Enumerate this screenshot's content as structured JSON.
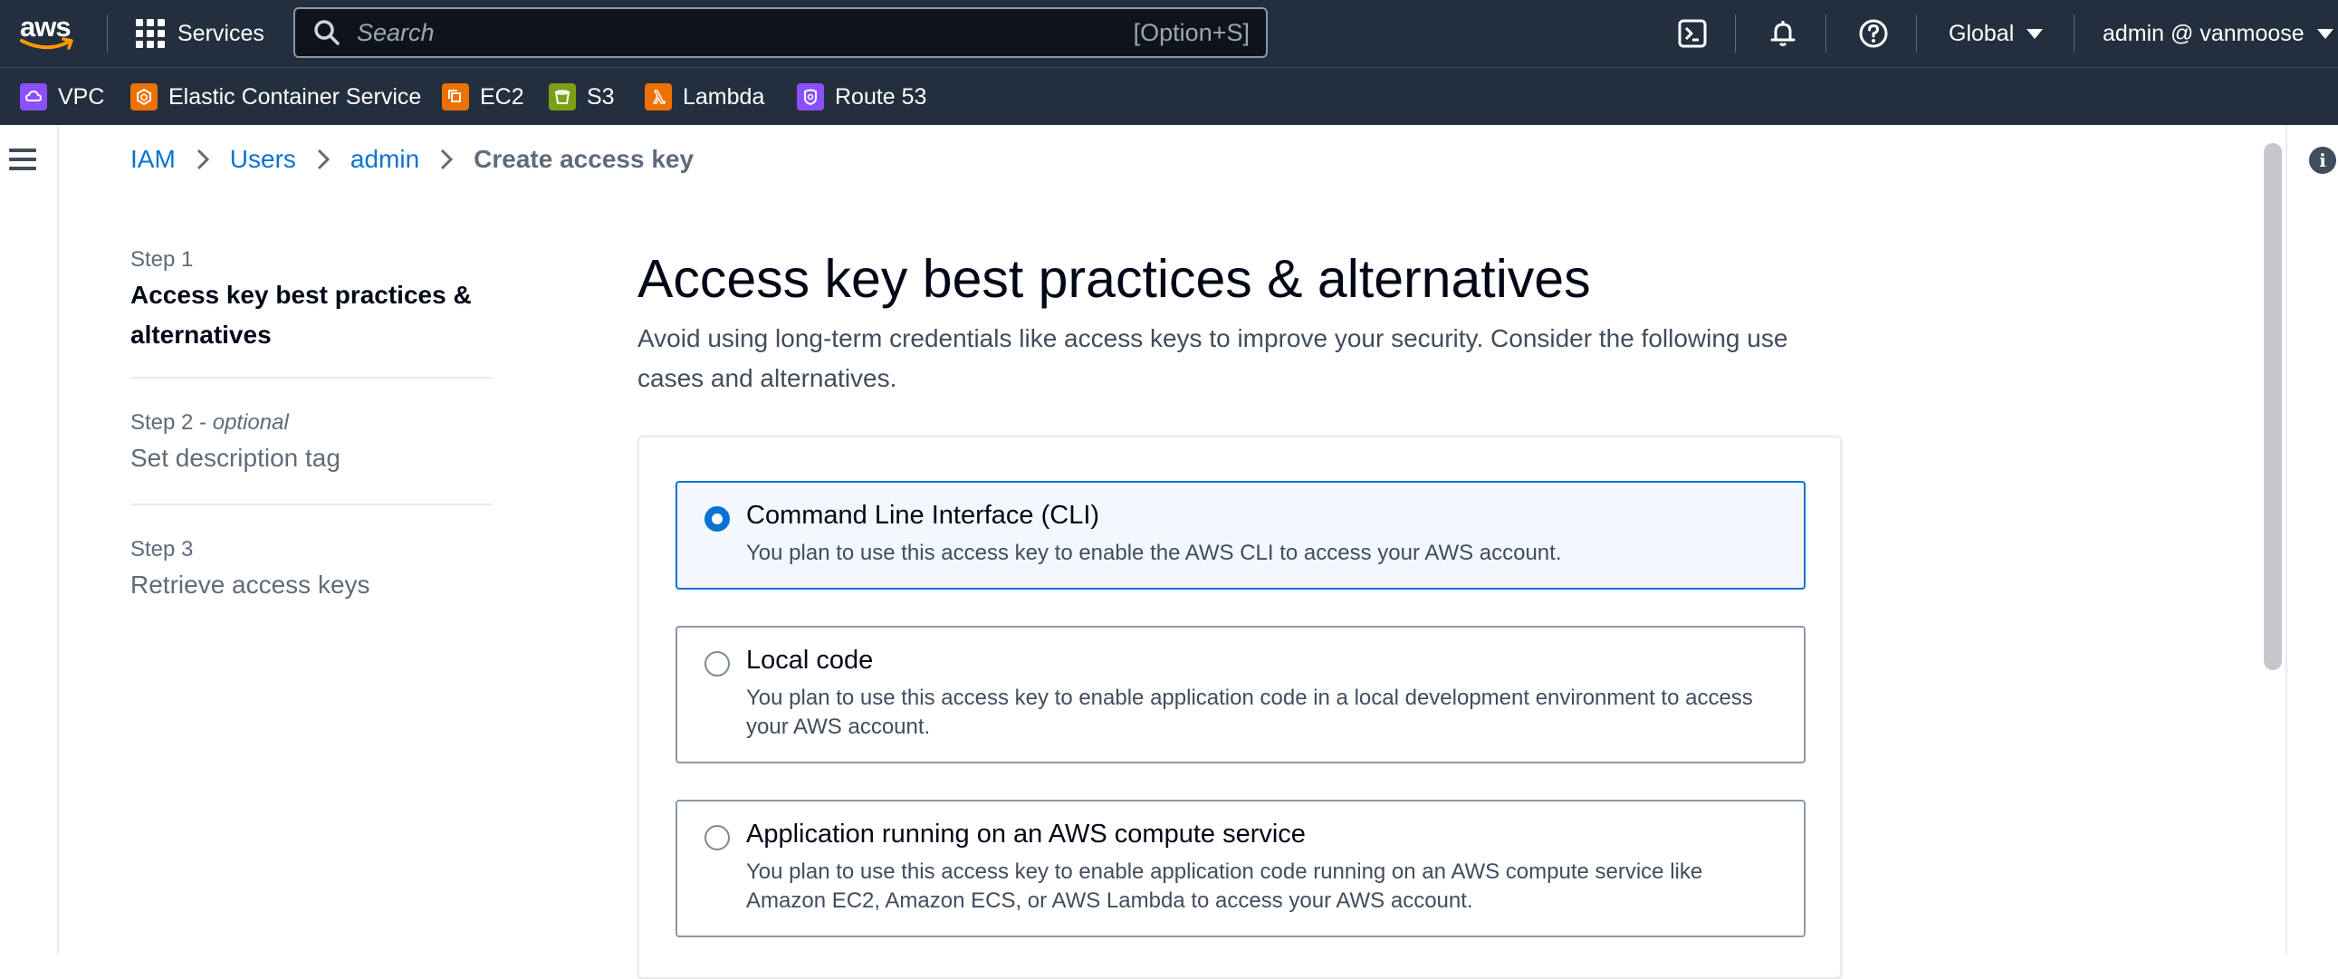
{
  "brand": {
    "logo_text": "aws"
  },
  "topnav": {
    "services_label": "Services",
    "search": {
      "placeholder": "Search",
      "shortcut": "[Option+S]"
    },
    "region": "Global",
    "account": "admin @ vanmoose"
  },
  "favorites": [
    {
      "label": "VPC",
      "icon": "vpc-icon",
      "color": "#8c4fff"
    },
    {
      "label": "Elastic Container Service",
      "icon": "ecs-icon",
      "color": "#ed7100"
    },
    {
      "label": "EC2",
      "icon": "ec2-icon",
      "color": "#ed7100"
    },
    {
      "label": "S3",
      "icon": "s3-icon",
      "color": "#7aa116"
    },
    {
      "label": "Lambda",
      "icon": "lambda-icon",
      "color": "#ed7100"
    },
    {
      "label": "Route 53",
      "icon": "route53-icon",
      "color": "#8c4fff"
    }
  ],
  "breadcrumb": {
    "items": [
      "IAM",
      "Users",
      "admin"
    ],
    "current": "Create access key"
  },
  "steps": [
    {
      "number": "Step 1",
      "optional": "",
      "title": "Access key best practices & alternatives",
      "active": true
    },
    {
      "number": "Step 2 - ",
      "optional": "optional",
      "title": "Set description tag",
      "active": false
    },
    {
      "number": "Step 3",
      "optional": "",
      "title": "Retrieve access keys",
      "active": false
    }
  ],
  "main": {
    "title": "Access key best practices & alternatives",
    "description": "Avoid using long-term credentials like access keys to improve your security. Consider the following use cases and alternatives.",
    "options": [
      {
        "title": "Command Line Interface (CLI)",
        "description": "You plan to use this access key to enable the AWS CLI to access your AWS account.",
        "selected": true
      },
      {
        "title": "Local code",
        "description": "You plan to use this access key to enable application code in a local development environment to access your AWS account.",
        "selected": false
      },
      {
        "title": "Application running on an AWS compute service",
        "description": "You plan to use this access key to enable application code running on an AWS compute service like Amazon EC2, Amazon ECS, or AWS Lambda to access your AWS account.",
        "selected": false
      }
    ]
  },
  "colors": {
    "nav_bg": "#232f3e",
    "link": "#0972d3",
    "selected_bg": "#f2f8fd",
    "aws_smile": "#ff9900"
  }
}
